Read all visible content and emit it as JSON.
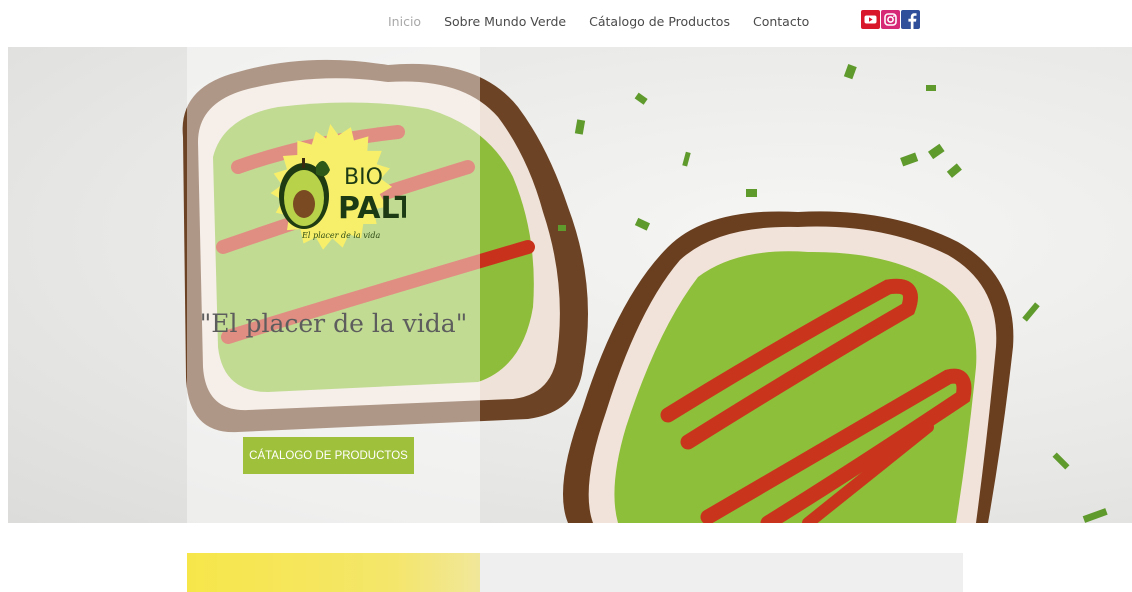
{
  "nav": {
    "items": [
      {
        "label": "Inicio",
        "active": true
      },
      {
        "label": "Sobre Mundo Verde",
        "active": false
      },
      {
        "label": "Cátalogo de Productos",
        "active": false
      },
      {
        "label": "Contacto",
        "active": false
      }
    ],
    "social_icons": [
      "youtube-icon",
      "instagram-icon",
      "facebook-icon"
    ]
  },
  "hero": {
    "logo": {
      "line1": "BIO",
      "line2": "PALT",
      "slogan": "El placer de la vida"
    },
    "tagline": "\"El placer de la vida\"",
    "cta_label": "CÁTALOGO DE PRODUCTOS"
  },
  "colors": {
    "accent_green": "#9fc03a",
    "youtube": "#d9172a",
    "instagram": "#d62976",
    "facebook": "#2f4f9a",
    "logo_yellow": "#f7ef6a"
  }
}
